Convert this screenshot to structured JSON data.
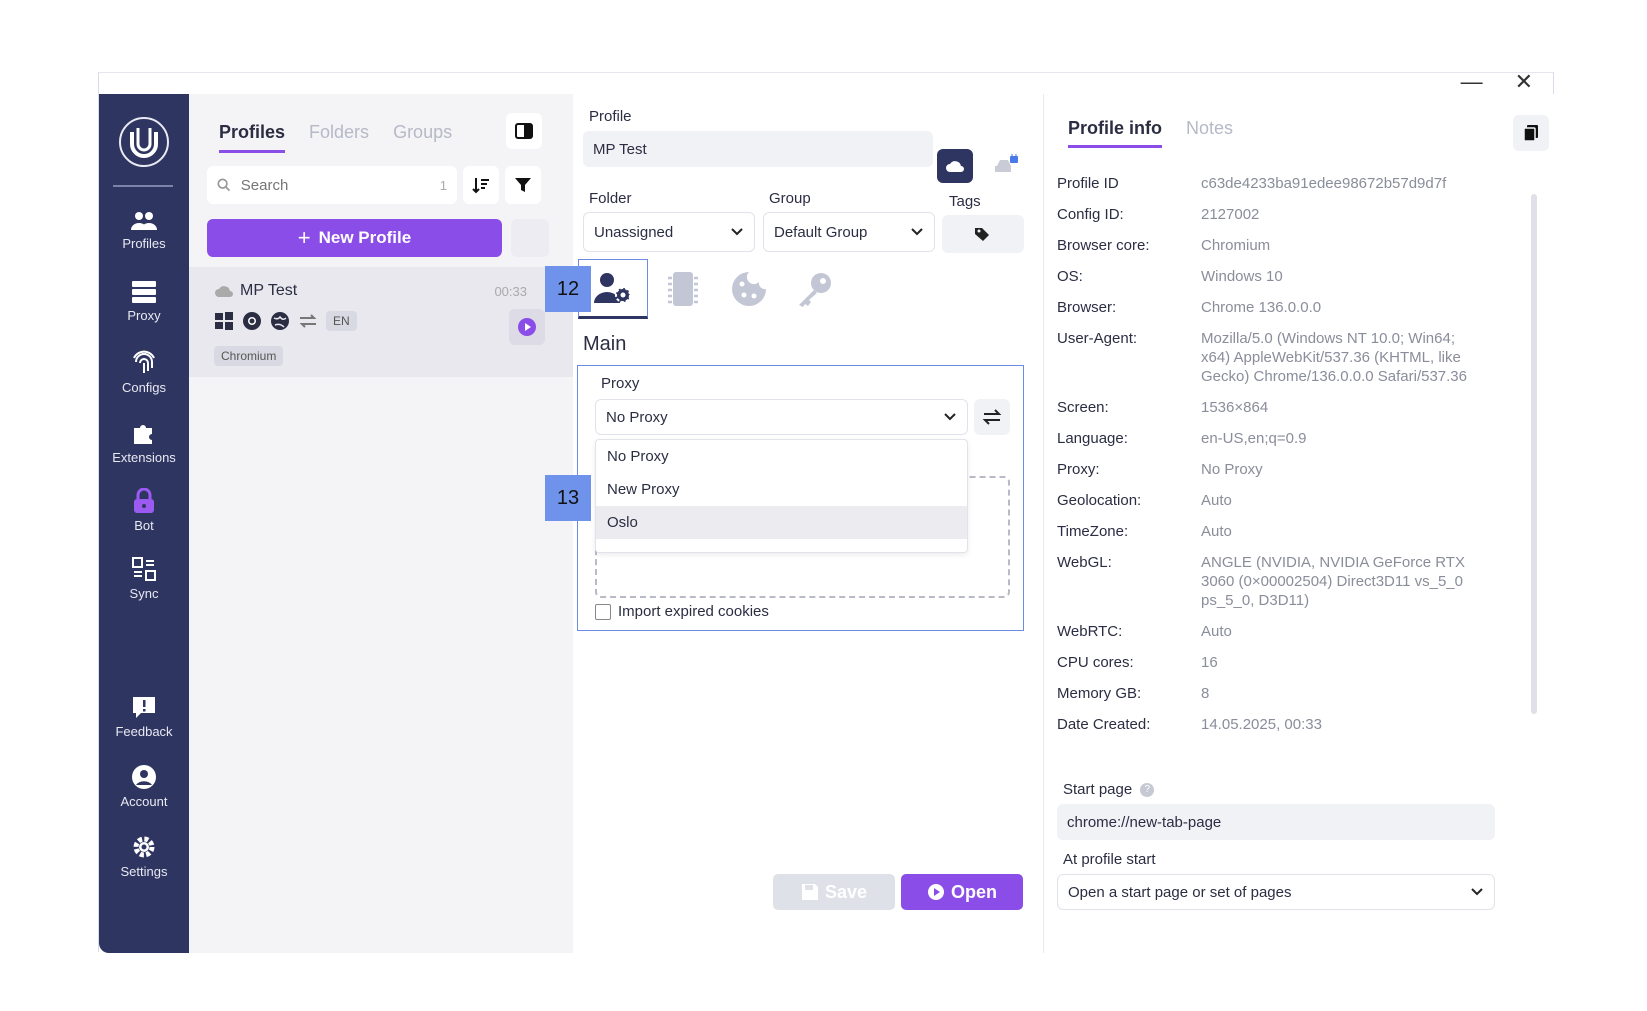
{
  "window": {
    "minimize": "—",
    "close": "✕"
  },
  "sidebar": {
    "items": [
      {
        "label": "Profiles",
        "icon": "users-icon"
      },
      {
        "label": "Proxy",
        "icon": "server-icon"
      },
      {
        "label": "Configs",
        "icon": "fingerprint-icon"
      },
      {
        "label": "Extensions",
        "icon": "puzzle-icon"
      },
      {
        "label": "Bot",
        "icon": "lock-icon"
      },
      {
        "label": "Sync",
        "icon": "sync-icon"
      },
      {
        "label": "Feedback",
        "icon": "feedback-icon"
      },
      {
        "label": "Account",
        "icon": "account-icon"
      },
      {
        "label": "Settings",
        "icon": "gear-icon"
      }
    ]
  },
  "profiles_panel": {
    "tabs": [
      "Profiles",
      "Folders",
      "Groups"
    ],
    "search_placeholder": "Search",
    "search_count": "1",
    "new_profile_label": "New Profile",
    "profile": {
      "name": "MP Test",
      "time": "00:33",
      "lang": "EN",
      "core": "Chromium"
    }
  },
  "editor": {
    "profile_label": "Profile",
    "profile_value": "MP Test",
    "folder_label": "Folder",
    "folder_value": "Unassigned",
    "group_label": "Group",
    "group_value": "Default Group",
    "tags_label": "Tags",
    "callouts": [
      "12",
      "13"
    ],
    "section_title": "Main",
    "proxy_label": "Proxy",
    "proxy_value": "No Proxy",
    "proxy_options": [
      "No Proxy",
      "New Proxy",
      "Oslo"
    ],
    "proxy_selected_highlight": "Oslo",
    "import_expired_label": "Import expired cookies",
    "save_label": "Save",
    "open_label": "Open"
  },
  "info": {
    "tabs": [
      "Profile info",
      "Notes"
    ],
    "rows": [
      {
        "k": "Profile ID",
        "v": "c63de4233ba91edee98672b57d9d7f"
      },
      {
        "k": "Config ID:",
        "v": "2127002"
      },
      {
        "k": "Browser core:",
        "v": "Chromium"
      },
      {
        "k": "OS:",
        "v": "Windows 10"
      },
      {
        "k": "Browser:",
        "v": "Chrome 136.0.0.0"
      },
      {
        "k": "User-Agent:",
        "v": "Mozilla/5.0 (Windows NT 10.0; Win64; x64) AppleWebKit/537.36 (KHTML, like Gecko) Chrome/136.0.0.0 Safari/537.36"
      },
      {
        "k": "Screen:",
        "v": "1536×864"
      },
      {
        "k": "Language:",
        "v": "en-US,en;q=0.9"
      },
      {
        "k": "Proxy:",
        "v": "No Proxy"
      },
      {
        "k": "Geolocation:",
        "v": "Auto"
      },
      {
        "k": "TimeZone:",
        "v": "Auto"
      },
      {
        "k": "WebGL:",
        "v": "ANGLE (NVIDIA, NVIDIA GeForce RTX 3060 (0×00002504) Direct3D11 vs_5_0 ps_5_0, D3D11)"
      },
      {
        "k": "WebRTC:",
        "v": "Auto"
      },
      {
        "k": "CPU cores:",
        "v": "16"
      },
      {
        "k": "Memory GB:",
        "v": "8"
      },
      {
        "k": "Date Created:",
        "v": "14.05.2025, 00:33"
      }
    ],
    "start_page_label": "Start page",
    "start_page_value": "chrome://new-tab-page",
    "at_profile_start_label": "At profile start",
    "at_profile_start_value": "Open a start page or set of pages"
  },
  "colors": {
    "accent": "#8b4de8",
    "sidebar": "#2e3560",
    "callout": "#6f92ea"
  }
}
